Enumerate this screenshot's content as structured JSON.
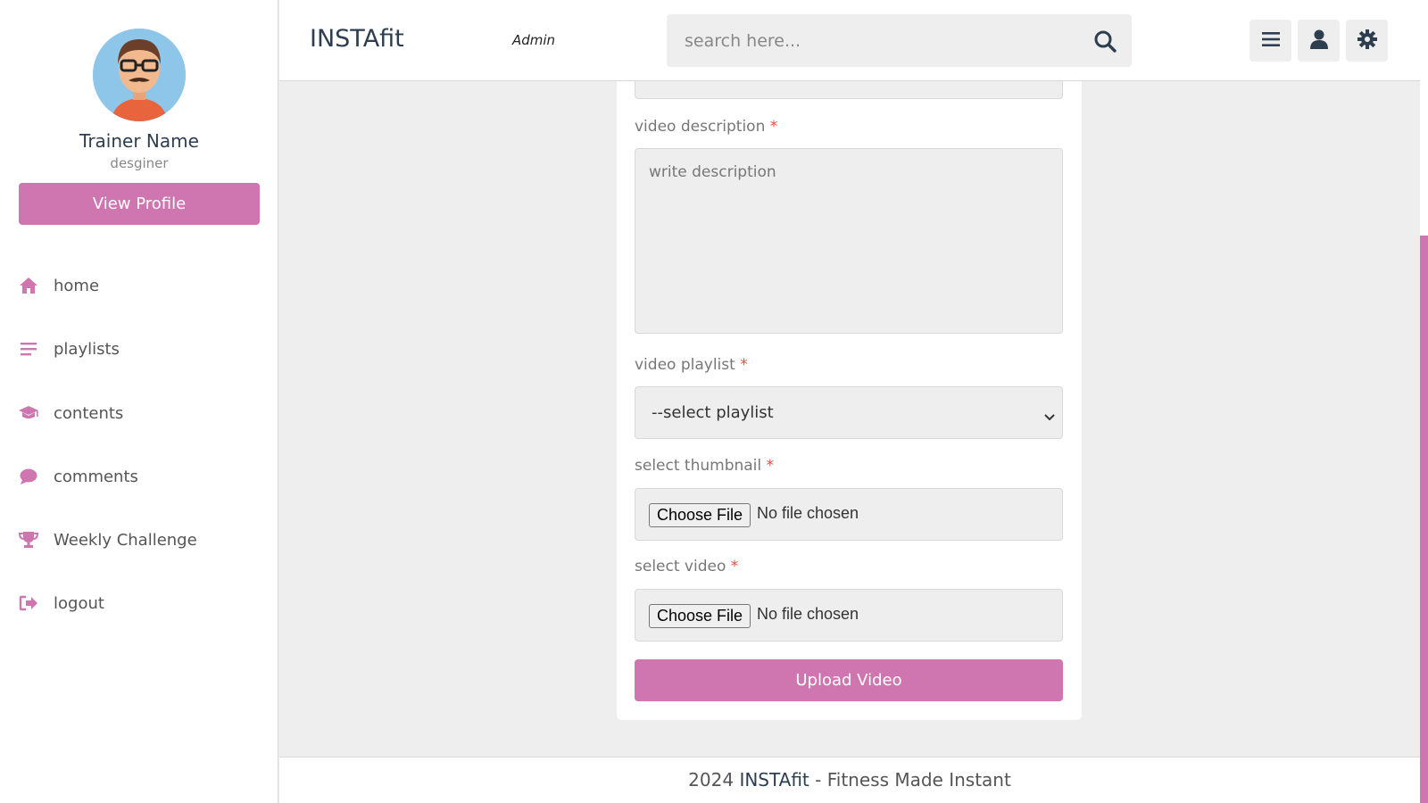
{
  "sidebar": {
    "profile": {
      "name": "Trainer Name",
      "role": "desginer",
      "view_profile_label": "View Profile"
    },
    "items": [
      {
        "label": "home",
        "icon": "home-icon"
      },
      {
        "label": "playlists",
        "icon": "list-icon"
      },
      {
        "label": "contents",
        "icon": "graduation-cap-icon"
      },
      {
        "label": "comments",
        "icon": "comment-icon"
      },
      {
        "label": "Weekly Challenge",
        "icon": "trophy-icon"
      },
      {
        "label": "logout",
        "icon": "logout-icon"
      }
    ]
  },
  "header": {
    "brand": "INSTAfit",
    "role": "Admin",
    "search": {
      "placeholder": "search here..."
    },
    "buttons": [
      "menu-icon",
      "user-icon",
      "gear-icon"
    ]
  },
  "form": {
    "description": {
      "label": "video description",
      "required_mark": "*",
      "placeholder": "write description"
    },
    "playlist": {
      "label": "video playlist",
      "required_mark": "*",
      "selected": "--select playlist"
    },
    "thumbnail": {
      "label": "select thumbnail",
      "required_mark": "*",
      "button": "Choose File",
      "status": "No file chosen"
    },
    "video": {
      "label": "select video",
      "required_mark": "*",
      "button": "Choose File",
      "status": "No file chosen"
    },
    "submit_label": "Upload Video"
  },
  "footer": {
    "year": "2024",
    "brand": "INSTAfit",
    "tagline": "- Fitness Made Instant"
  },
  "colors": {
    "accent": "#cf76b0",
    "text": "#2c3e50",
    "background": "#eeeeee",
    "required": "#e74c3c"
  }
}
